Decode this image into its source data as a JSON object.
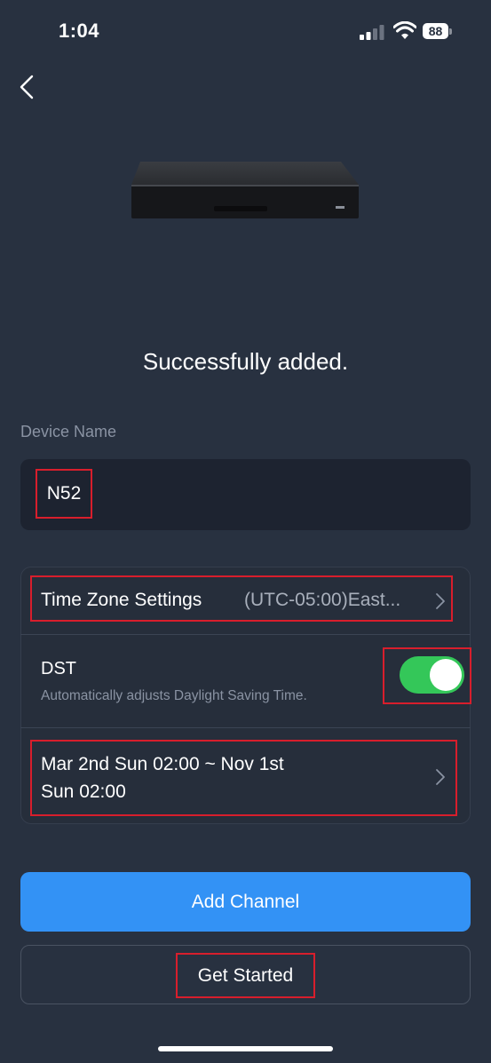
{
  "status_bar": {
    "time": "1:04",
    "battery": "88",
    "icons": [
      "signal-icon",
      "wifi-icon",
      "battery-icon"
    ]
  },
  "nav": {
    "back_icon": "chevron-left-icon"
  },
  "device": {
    "image": "nvr-recorder-image"
  },
  "page": {
    "title": "Successfully added."
  },
  "device_name": {
    "label": "Device Name",
    "value": "N52"
  },
  "settings": {
    "time_zone_label": "Time Zone Settings",
    "time_zone_value": "(UTC-05:00)East...",
    "dst_label": "DST",
    "dst_description": "Automatically adjusts Daylight Saving Time.",
    "dst_enabled": true,
    "dst_range_line1": "Mar 2nd Sun 02:00 ~ Nov 1st",
    "dst_range_line2": "Sun 02:00"
  },
  "actions": {
    "add_channel": "Add Channel",
    "get_started": "Get Started"
  },
  "colors": {
    "background": "#283140",
    "primary_button": "#3392f5",
    "toggle_on": "#34c759",
    "highlight_box": "#d81e2c"
  }
}
